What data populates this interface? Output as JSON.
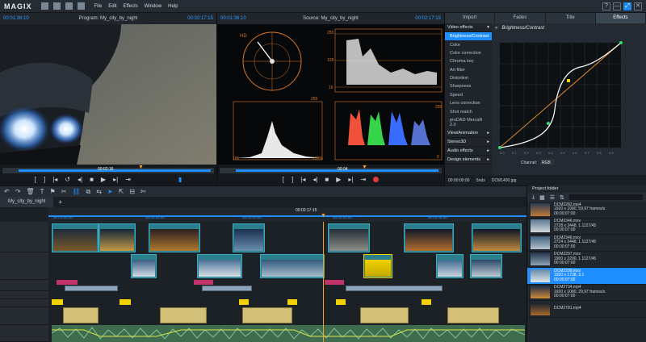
{
  "app": {
    "logo": "MAGIX",
    "menu": [
      "File",
      "Edit",
      "Effects",
      "Window",
      "Help"
    ],
    "window_buttons": [
      "?",
      "—",
      "⤢",
      "✕"
    ]
  },
  "program_monitor": {
    "timecode_left": "00:01:36:10",
    "title": "Program: My_city_by_night",
    "timecode_right": "00:02:17:15",
    "scrub_time": "00:02:16"
  },
  "source_monitor": {
    "timecode_left": "00:01:36:10",
    "title": "Source: My_city_by_night",
    "timecode_right": "00:02:17:15",
    "scrub_time": "00:04",
    "scope_labels": {
      "vector": "HD",
      "wave_top": "255",
      "wave_mid": "235",
      "wave_low": "128",
      "wave_bottom": "16",
      "hist_min": "0",
      "hist_max": "255",
      "hist_pct_left": "0%",
      "hist_pct_right": "100%",
      "rgb_top": "255",
      "rgb_bottom": "0"
    }
  },
  "effects_panel": {
    "tabs": [
      "Import",
      "Fades",
      "Title",
      "Effects"
    ],
    "active_tab": "Effects",
    "categories_top": "Video effects",
    "items": [
      "Brightness/Contrast",
      "Color",
      "Color correction",
      "Chroma key",
      "Art filter",
      "Distortion",
      "Sharpness",
      "Speed",
      "Lens correction",
      "Shot match",
      "proDAD Mercalli 2.0"
    ],
    "categories_bottom": [
      "View/Animation",
      "Stereo3D",
      "Audio effects",
      "Design elements"
    ],
    "selected": "Brightness/Contrast",
    "curve_title": "Brightness/Contrast",
    "channel_label": "Channel:",
    "channel_value": "RGB",
    "curve_ticks": [
      "0.0",
      "0.1",
      "0.2",
      "0.3",
      "0.4",
      "0.5",
      "0.6",
      "0.7",
      "0.8",
      "0.9",
      "1.0"
    ],
    "footer_time": "00:00:00:00",
    "footer_mode": "Snds",
    "footer_file": "DCM1400.jpg"
  },
  "timeline": {
    "project_tab": "My_city_by_night",
    "ruler_center": "00:02:17:15",
    "ruler_marks": [
      "00:01:00:00",
      "00:01:24:00",
      "00:02:00:00",
      "00:02:24:00",
      "00:02:48:00"
    ]
  },
  "project_folder": {
    "title": "Project folder",
    "files": [
      {
        "name": "DCM2282.mp4",
        "dims": "1920 x 1080, 59,97 frames/s",
        "dur": "00:00:07:00"
      },
      {
        "name": "DCM2346.mxv",
        "dims": "2728 x 2448, 1.1127/45",
        "dur": "00:00:07:00"
      },
      {
        "name": "DCM2346.mxv",
        "dims": "2724 x 2448, 1.1127/45",
        "dur": "00:00:07:00"
      },
      {
        "name": "DCM2297.mxv",
        "dims": "1900 x 2200, 1.1127/45",
        "dur": "00:00:07:00"
      },
      {
        "name": "DCM2299.mxv",
        "dims": "1920 x 1738, 3.1",
        "dur": "00:00:07:00"
      },
      {
        "name": "DCM2734.mp4",
        "dims": "1920 x 1080, 29,97 frames/s",
        "dur": "00:00:07:00"
      },
      {
        "name": "DCM2781.mp4",
        "dims": "",
        "dur": ""
      }
    ],
    "selected_index": 4
  },
  "colors": {
    "accent": "#1f8fff",
    "clip": "#2b7f8c",
    "audio": "#d2c078",
    "playhead": "#ff9f1a"
  }
}
